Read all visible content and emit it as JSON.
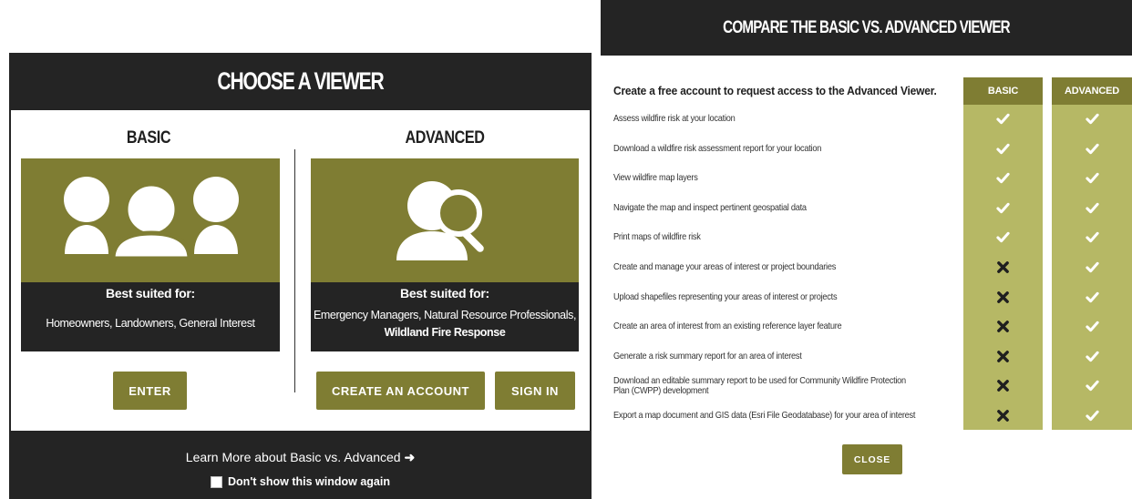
{
  "chooser": {
    "title": "CHOOSE A VIEWER",
    "basic": {
      "title": "BASIC",
      "best_label": "Best suited for:",
      "audience": "Homeowners, Landowners, General Interest",
      "icon": "users-group-icon",
      "enter_label": "ENTER"
    },
    "advanced": {
      "title": "ADVANCED",
      "best_label": "Best suited for:",
      "audience_line1": "Emergency Managers, Natural Resource Professionals,",
      "audience_line2": "Wildland Fire Response",
      "icon": "user-search-icon",
      "create_label": "CREATE AN ACCOUNT",
      "signin_label": "SIGN IN"
    },
    "learn_more": "Learn More about Basic vs. Advanced",
    "dont_show": "Don't show this window again"
  },
  "compare": {
    "title": "COMPARE THE BASIC VS. ADVANCED VIEWER",
    "heading": "Create a free account to request access to the Advanced Viewer.",
    "col_basic": "BASIC",
    "col_advanced": "ADVANCED",
    "rows": [
      {
        "label": "Assess wildfire risk at your location",
        "basic": true,
        "advanced": true
      },
      {
        "label": "Download a wildfire risk assessment report for your location",
        "basic": true,
        "advanced": true
      },
      {
        "label": "View wildfire map layers",
        "basic": true,
        "advanced": true
      },
      {
        "label": "Navigate the map and inspect pertinent geospatial data",
        "basic": true,
        "advanced": true
      },
      {
        "label": "Print maps of wildfire risk",
        "basic": true,
        "advanced": true
      },
      {
        "label": "Create and manage your areas of interest or project boundaries",
        "basic": false,
        "advanced": true
      },
      {
        "label": "Upload shapefiles representing your areas of interest or projects",
        "basic": false,
        "advanced": true
      },
      {
        "label": "Create an area of interest from an existing reference layer feature",
        "basic": false,
        "advanced": true
      },
      {
        "label": "Generate a risk summary report for an area of interest",
        "basic": false,
        "advanced": true
      },
      {
        "label": "Download an editable summary report to be used for Community Wildfire Protection Plan (CWPP) development",
        "basic": false,
        "advanced": true
      },
      {
        "label": "Export a map document and GIS data (Esri File Geodatabase) for your area of interest",
        "basic": false,
        "advanced": true
      }
    ],
    "close_label": "CLOSE"
  },
  "colors": {
    "olive": "#7f7d33",
    "olive_light": "#b6b865",
    "dark": "#242424"
  }
}
